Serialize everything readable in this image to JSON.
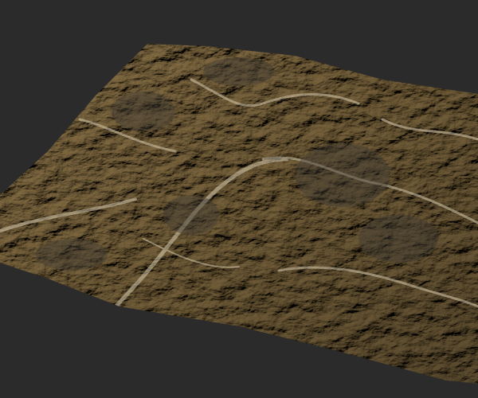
{
  "scene": {
    "background_color": "#2b2b2b",
    "terrain_color": "#8c7d60",
    "terrain_shadow_color": "#3f3a33",
    "wash_color": "#d8ccb0",
    "subject": "eroded-terrain-heightmap"
  }
}
